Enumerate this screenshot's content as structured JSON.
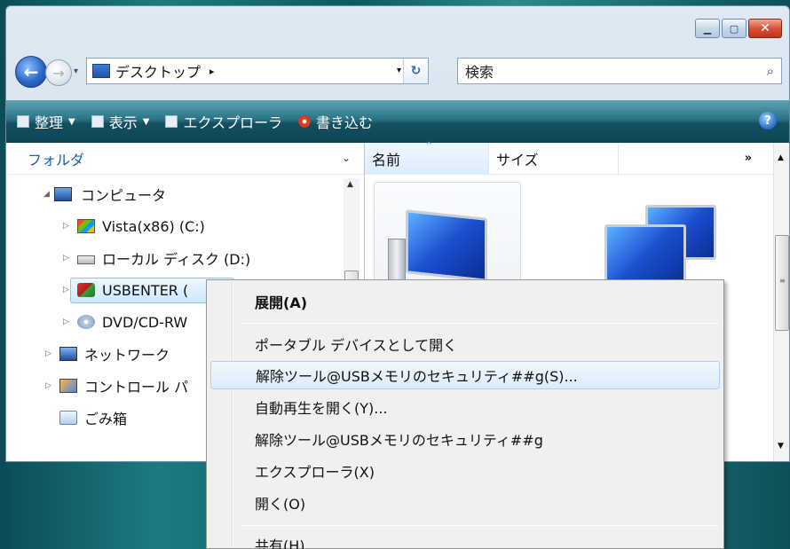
{
  "window": {
    "caption_buttons": [
      "minimize",
      "maximize",
      "close"
    ]
  },
  "address_bar": {
    "location": "デスクトップ",
    "breadcrumb_arrow": "▸",
    "dropdown_arrow": "▾",
    "search_placeholder": "検索"
  },
  "command_bar": {
    "organize": "整理",
    "views": "表示",
    "explore": "エクスプローラ",
    "burn": "書き込む"
  },
  "navigation_pane": {
    "header": "フォルダ",
    "tree": [
      {
        "label": "コンピュータ",
        "icon": "computer-icon",
        "expanded": true
      },
      {
        "label": "Vista(x86) (C:)",
        "icon": "vista-drive-icon"
      },
      {
        "label": "ローカル ディスク (D:)",
        "icon": "drive-icon"
      },
      {
        "label": "USBENTER (",
        "icon": "usb-drive-icon",
        "selected": true
      },
      {
        "label": "DVD/CD-RW",
        "icon": "dvd-drive-icon"
      },
      {
        "label": "ネットワーク",
        "icon": "network-icon"
      },
      {
        "label": "コントロール パ",
        "icon": "control-panel-icon"
      },
      {
        "label": "ごみ箱",
        "icon": "recycle-bin-icon"
      }
    ]
  },
  "content_pane": {
    "columns": [
      "名前",
      "サイズ"
    ],
    "more": "»"
  },
  "context_menu": {
    "items": [
      {
        "label": "展開(A)",
        "bold": true
      },
      {
        "label": "ポータブル デバイスとして開く"
      },
      {
        "label": "解除ツール@USBメモリのセキュリティ##g(S)...",
        "hover": true
      },
      {
        "label": "自動再生を開く(Y)..."
      },
      {
        "label": "解除ツール@USBメモリのセキュリティ##g"
      },
      {
        "label": "エクスプローラ(X)"
      },
      {
        "label": "開く(O)"
      },
      {
        "label": "共有(H)..."
      }
    ]
  },
  "colors": {
    "command_bar": "#134f5f",
    "accent": "#1e5ea8",
    "hover": "#dcebfb"
  }
}
